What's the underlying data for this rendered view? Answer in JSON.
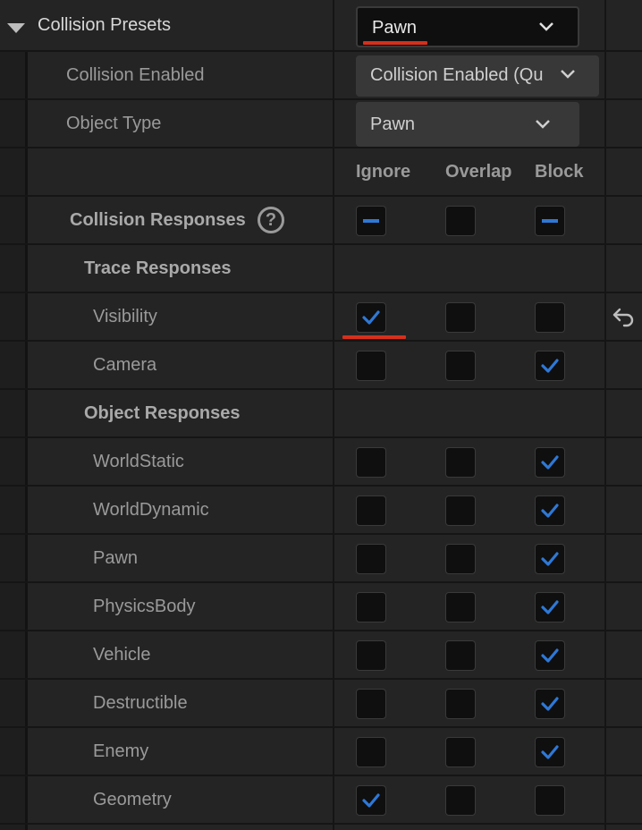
{
  "collision_presets": {
    "label": "Collision Presets",
    "value": "Pawn"
  },
  "collision_enabled": {
    "label": "Collision Enabled",
    "value": "Collision Enabled (Qu"
  },
  "object_type": {
    "label": "Object Type",
    "value": "Pawn"
  },
  "columns": {
    "ignore": "Ignore",
    "overlap": "Overlap",
    "block": "Block"
  },
  "collision_responses": {
    "label": "Collision Responses",
    "help": "?",
    "ignore": "partial",
    "overlap": "unchecked",
    "block": "partial"
  },
  "trace_responses": {
    "label": "Trace Responses"
  },
  "object_responses": {
    "label": "Object Responses"
  },
  "trace_channels": [
    {
      "label": "Visibility",
      "ignore": true,
      "overlap": false,
      "block": false
    },
    {
      "label": "Camera",
      "ignore": false,
      "overlap": false,
      "block": true
    }
  ],
  "object_channels": [
    {
      "label": "WorldStatic",
      "ignore": false,
      "overlap": false,
      "block": true
    },
    {
      "label": "WorldDynamic",
      "ignore": false,
      "overlap": false,
      "block": true
    },
    {
      "label": "Pawn",
      "ignore": false,
      "overlap": false,
      "block": true
    },
    {
      "label": "PhysicsBody",
      "ignore": false,
      "overlap": false,
      "block": true
    },
    {
      "label": "Vehicle",
      "ignore": false,
      "overlap": false,
      "block": true
    },
    {
      "label": "Destructible",
      "ignore": false,
      "overlap": false,
      "block": true
    },
    {
      "label": "Enemy",
      "ignore": false,
      "overlap": false,
      "block": true
    },
    {
      "label": "Geometry",
      "ignore": true,
      "overlap": false,
      "block": false
    }
  ],
  "icons": {
    "reset": "reset-arrow-icon",
    "expand": "expand-arrow-icon",
    "chevron": "chevron-down-icon",
    "check": "check-icon",
    "partial": "partial-minus-icon"
  },
  "colors": {
    "check": "#2e78d6",
    "highlight": "#d6301c",
    "panel": "#242424"
  }
}
